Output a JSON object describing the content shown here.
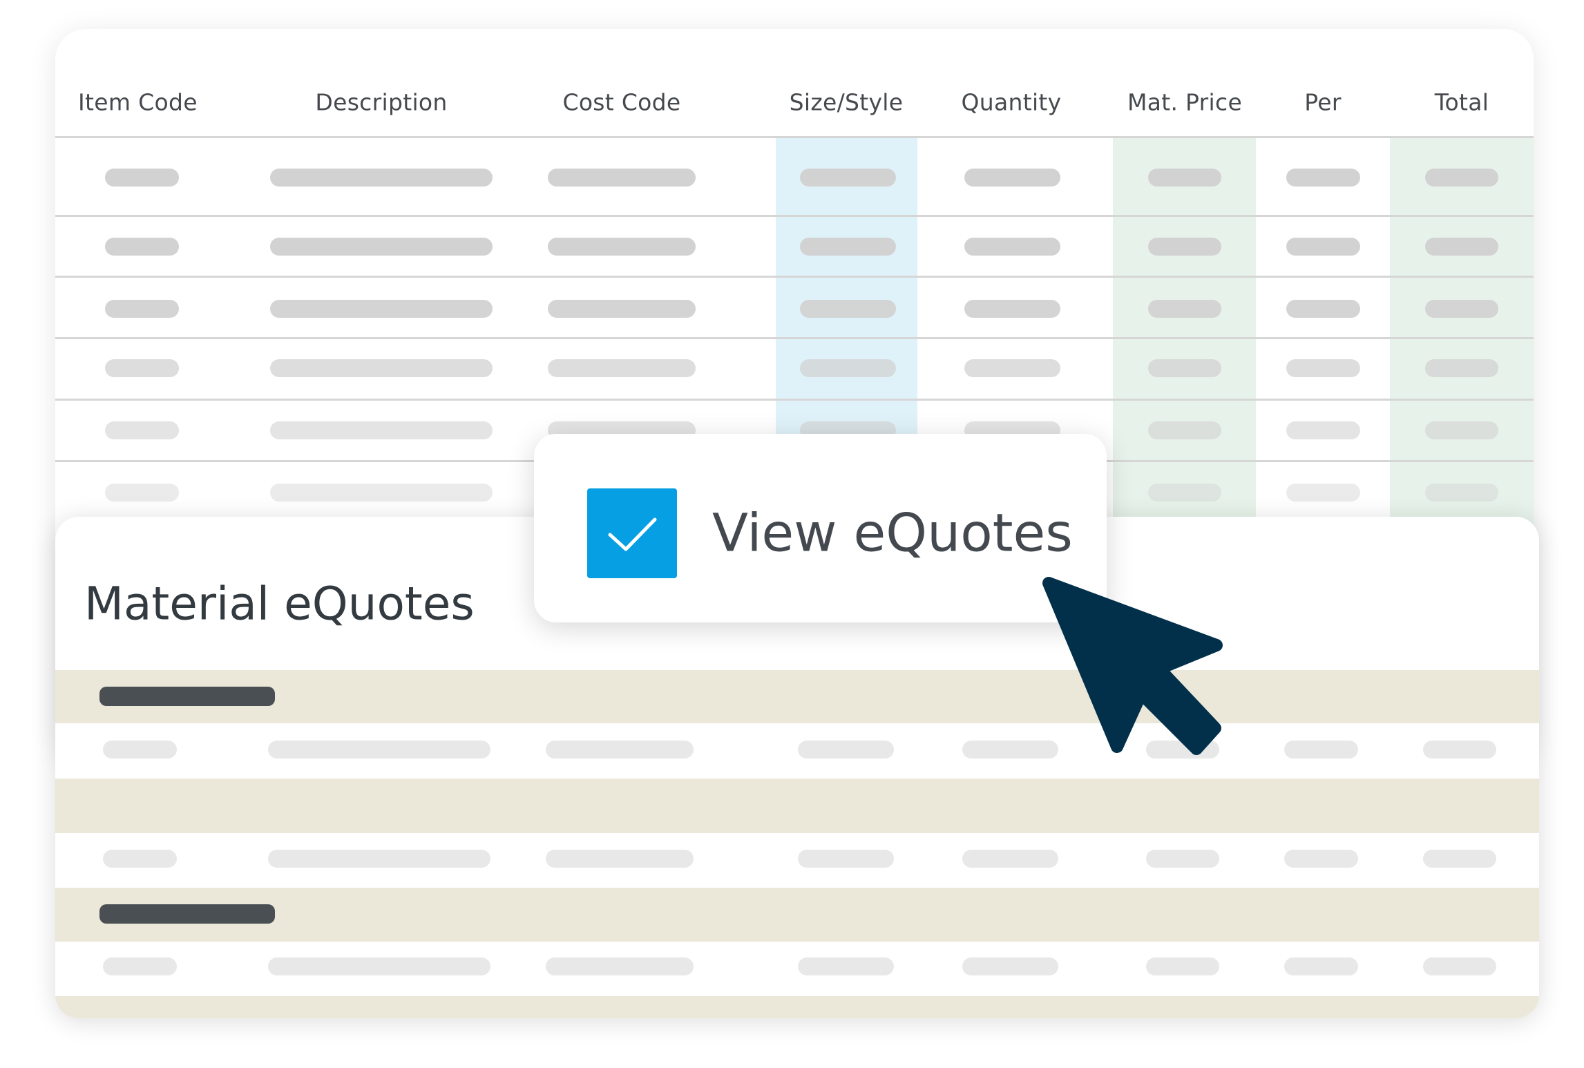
{
  "table": {
    "columns": [
      "Item Code",
      "Description",
      "Cost Code",
      "Size/Style",
      "Quantity",
      "Mat. Price",
      "Per",
      "Total"
    ],
    "placeholder_row_count": 6
  },
  "equotes": {
    "title": "Material eQuotes"
  },
  "popup": {
    "checkbox_checked": true,
    "label": "View eQuotes"
  },
  "colors": {
    "accent_blue": "#079fe3",
    "cursor_navy": "#02304a",
    "size_column_highlight": "#e0f2f9",
    "price_column_highlight": "#e7f3ea",
    "group_band": "#ebe8d9",
    "header_text": "#46494d"
  },
  "icons": {
    "checkbox": "checkmark-icon",
    "pointer": "mouse-pointer-icon"
  }
}
